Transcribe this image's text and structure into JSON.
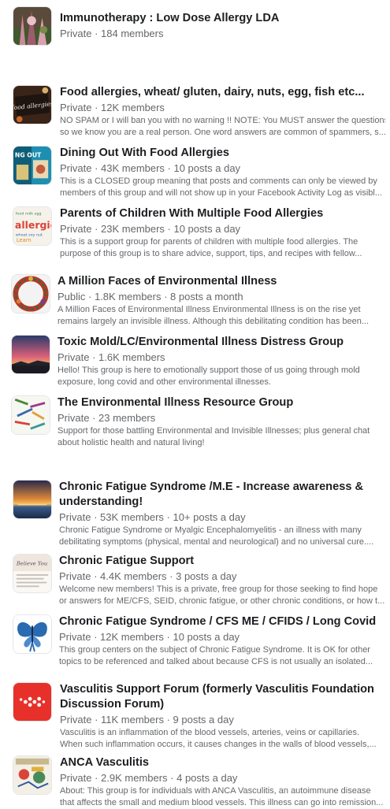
{
  "groups": [
    {
      "name": "Immunotherapy : Low Dose Allergy LDA",
      "meta": "Private · 184 members",
      "desc": []
    },
    {
      "name": "Food allergies, wheat/ gluten, dairy, nuts, egg, fish etc...",
      "meta": "Private · 12K members",
      "desc": [
        "NO SPAM or I will ban you with no warning !! NOTE: You MUST answer the questions",
        "so we know you are a real person. One word answers are common of spammers, s..."
      ],
      "thumb_text": "food allergies"
    },
    {
      "name": "Dining Out With Food Allergies",
      "meta": "Private · 43K members · 10 posts a day",
      "desc": [
        "This is a CLOSED group meaning that posts and comments can only be viewed by",
        "members of this group and will not show up in your Facebook Activity Log as visibl..."
      ],
      "thumb_text": "NG OUT"
    },
    {
      "name": "Parents of Children With Multiple Food Allergies",
      "meta": "Private · 23K members · 10 posts a day",
      "desc": [
        "This is a support group for parents of children with multiple food allergies. The",
        "purpose of this group is to share advice, support, tips, and recipes with fellow..."
      ],
      "thumb_text": "allergie"
    },
    {
      "name": "A Million Faces of Environmental Illness",
      "meta": "Public · 1.8K members · 8 posts a month",
      "desc": [
        "A Million Faces of Environmental Illness Environmental Illness is on the rise yet",
        "remains largely an invisible illness. Although this debilitating condition has been..."
      ]
    },
    {
      "name": "Toxic Mold/LC/Environmental Illness Distress Group",
      "meta": "Private · 1.6K members",
      "desc": [
        "Hello! This group is here to emotionally support those of us going through mold",
        "exposure, long covid and other environmental illnesses."
      ]
    },
    {
      "name": "The Environmental Illness Resource Group",
      "meta": "Private · 23 members",
      "desc": [
        "Support for those battling Environmental and Invisible Illnesses; plus general chat",
        "about holistic health and natural living!"
      ]
    },
    {
      "name": "Chronic Fatigue Syndrome /M.E - Increase awareness & understanding!",
      "meta": "Private · 53K members · 10+ posts a day",
      "desc": [
        "Chronic Fatigue Syndrome or Myalgic Encephalomyelitis - an illness with many",
        "debilitating symptoms (physical, mental and neurological) and no universal cure...."
      ]
    },
    {
      "name": "Chronic Fatigue Support",
      "meta": "Private · 4.4K members · 3 posts a day",
      "desc": [
        "Welcome new members! This is a private, free group for those seeking to find hope",
        "or answers for ME/CFS, SEID, chronic fatigue, or other chronic conditions, or how t..."
      ],
      "thumb_text": "Believe You"
    },
    {
      "name": "Chronic Fatigue Syndrome / CFS ME / CFIDS / Long Covid",
      "meta": "Private · 12K members · 10 posts a day",
      "desc": [
        "This group centers on the subject of Chronic Fatigue Syndrome. It is OK for other",
        "topics to be referenced and talked about because CFS is not usually an isolated..."
      ]
    },
    {
      "name": "Vasculitis Support Forum (formerly Vasculitis Foundation Discussion Forum)",
      "meta": "Private · 11K members · 9 posts a day",
      "desc": [
        "Vasculitis is an inflammation of the blood vessels, arteries, veins or capillaries.",
        "When such inflammation occurs, it causes changes in the walls of blood vessels,..."
      ]
    },
    {
      "name": "ANCA Vasculitis",
      "meta": "Private · 2.9K members · 4 posts a day",
      "desc": [
        "About: This group is for individuals with ANCA Vasculitis, an autoimmune disease",
        "that affects the small and medium blood vessels. This illness can go into remission..."
      ]
    }
  ]
}
